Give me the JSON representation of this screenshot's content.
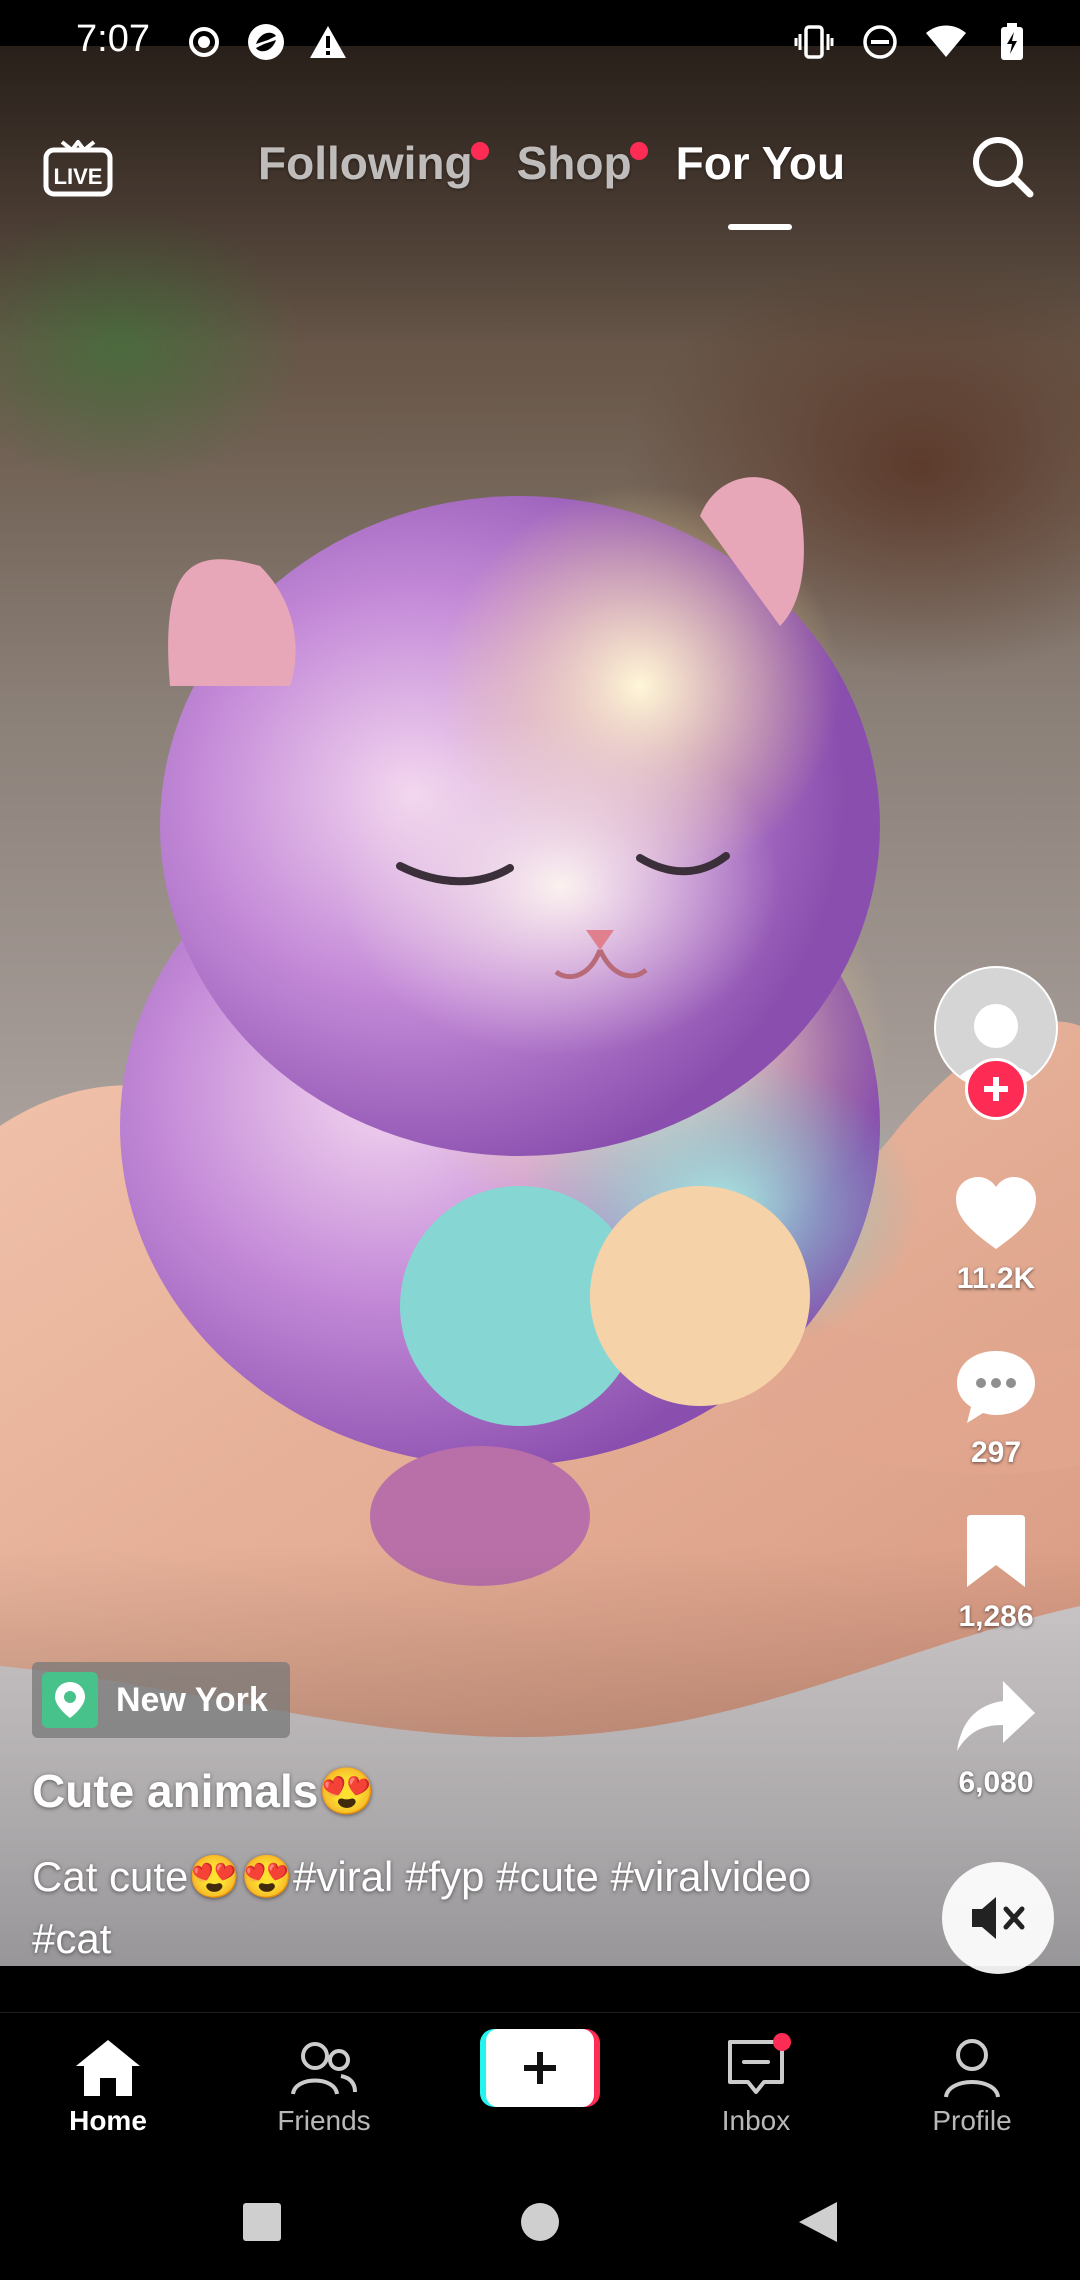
{
  "status_bar": {
    "time": "7:07",
    "left_icons": [
      "record-icon",
      "app-badge-icon",
      "warning-icon"
    ],
    "right_icons": [
      "vibrate-icon",
      "do-not-disturb-icon",
      "wifi-icon",
      "battery-charging-icon"
    ]
  },
  "top_nav": {
    "live_label": "LIVE",
    "tabs": [
      {
        "label": "Following",
        "has_dot": true
      },
      {
        "label": "Shop",
        "has_dot": true
      },
      {
        "label": "For You",
        "active": true
      }
    ]
  },
  "actions": {
    "likes": "11.2K",
    "comments": "297",
    "saves": "1,286",
    "shares": "6,080"
  },
  "caption": {
    "location": "New York",
    "title": "Cute animals😍",
    "text": "Cat cute😍😍#viral #fyp #cute #viralvideo #cat"
  },
  "bottom_tabs": {
    "home": "Home",
    "friends": "Friends",
    "inbox": "Inbox",
    "profile": "Profile"
  },
  "colors": {
    "accent": "#fe2c55",
    "create_cyan": "#25f4ee",
    "location_green": "#48c28b"
  }
}
